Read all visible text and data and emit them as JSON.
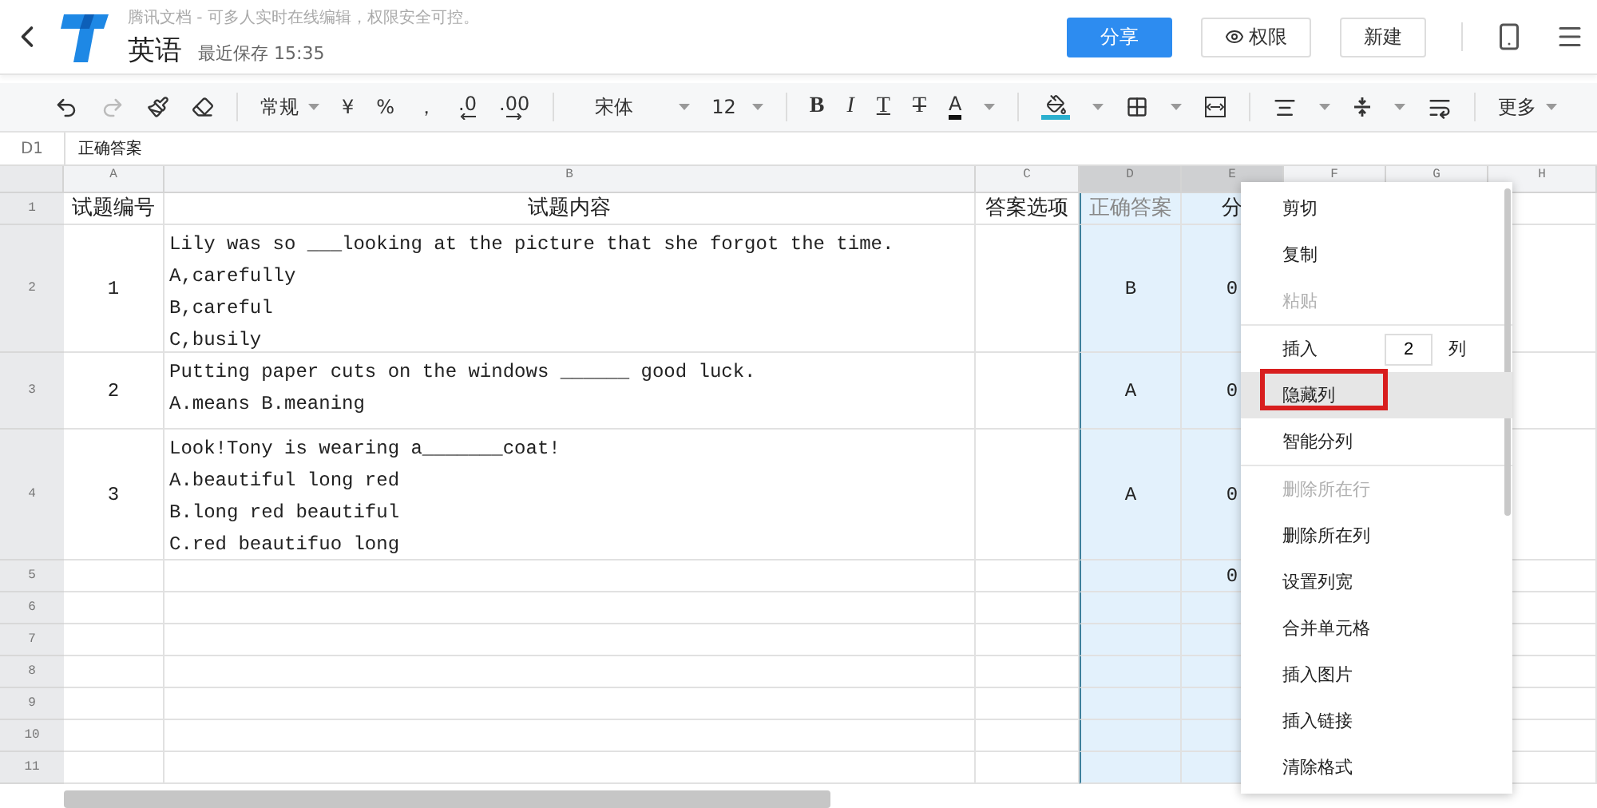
{
  "header": {
    "tagline": "腾讯文档 - 可多人实时在线编辑，权限安全可控。",
    "doc_title": "英语",
    "save_status": "最近保存 15:35",
    "buttons": [
      {
        "label": "分享",
        "kind": "primary"
      },
      {
        "label": "权限",
        "kind": "eye"
      },
      {
        "label": "新建",
        "kind": "plain"
      }
    ]
  },
  "toolbar": {
    "number_format": "常规",
    "currency": "¥",
    "percent": "%",
    "thousands": "，",
    "decimal_less": ".0",
    "decimal_more": ".00",
    "font": "宋体",
    "size": "12",
    "bold": "B",
    "italic": "I",
    "underline": "T",
    "strike": "T",
    "font_color": "A",
    "more": "更多"
  },
  "formula_bar": {
    "cell": "D1",
    "value": "正确答案"
  },
  "sheet": {
    "columns": [
      {
        "label": "A",
        "selected": false
      },
      {
        "label": "B",
        "selected": false
      },
      {
        "label": "C",
        "selected": false
      },
      {
        "label": "D",
        "selected": true
      },
      {
        "label": "E",
        "selected": true
      },
      {
        "label": "F",
        "selected": false
      },
      {
        "label": "G",
        "selected": false
      },
      {
        "label": "H",
        "selected": false
      }
    ],
    "rows": [
      {
        "number": "1",
        "cells": {
          "A": [
            "试题编号"
          ],
          "B": [
            "试题内容"
          ],
          "C": [
            "答案选项"
          ],
          "D": [
            "正确答案"
          ],
          "E": [
            "分"
          ]
        }
      },
      {
        "number": "2",
        "cells": {
          "A": [
            "1"
          ],
          "B": [
            "Lily was so ___looking at the picture that she forgot the time.",
            "A,carefully",
            "B,careful",
            "C,busily"
          ],
          "D": [
            "B"
          ],
          "E": [
            "0"
          ]
        }
      },
      {
        "number": "3",
        "cells": {
          "A": [
            "2"
          ],
          "B": [
            "Putting paper cuts on the windows ______ good luck.",
            "A.means B.meaning"
          ],
          "D": [
            "A"
          ],
          "E": [
            "0"
          ]
        }
      },
      {
        "number": "4",
        "cells": {
          "A": [
            "3"
          ],
          "B": [
            "Look!Tony is wearing a_______coat!",
            "A.beautiful long red",
            "B.long red beautiful",
            "C.red beautifuo long"
          ],
          "D": [
            "A"
          ],
          "E": [
            "0"
          ]
        }
      },
      {
        "number": "5",
        "cells": {
          "E": [
            "0"
          ]
        }
      },
      {
        "number": "6",
        "cells": {}
      },
      {
        "number": "7",
        "cells": {}
      },
      {
        "number": "8",
        "cells": {}
      },
      {
        "number": "9",
        "cells": {}
      },
      {
        "number": "10",
        "cells": {}
      },
      {
        "number": "11",
        "cells": {}
      }
    ]
  },
  "context_menu": {
    "items": [
      {
        "kind": "item",
        "label": "剪切",
        "disabled": false,
        "selected": false
      },
      {
        "kind": "item",
        "label": "复制",
        "disabled": false,
        "selected": false
      },
      {
        "kind": "item",
        "label": "粘贴",
        "disabled": true,
        "selected": false
      },
      {
        "kind": "separator"
      },
      {
        "kind": "insert",
        "label": "插入",
        "value": "2",
        "unit": "列",
        "disabled": false,
        "selected": false
      },
      {
        "kind": "item",
        "label": "隐藏列",
        "disabled": false,
        "selected": true
      },
      {
        "kind": "item",
        "label": "智能分列",
        "disabled": false,
        "selected": false
      },
      {
        "kind": "separator"
      },
      {
        "kind": "item",
        "label": "删除所在行",
        "disabled": true,
        "selected": false
      },
      {
        "kind": "item",
        "label": "删除所在列",
        "disabled": false,
        "selected": false
      },
      {
        "kind": "item",
        "label": "设置列宽",
        "disabled": false,
        "selected": false
      },
      {
        "kind": "item",
        "label": "合并单元格",
        "disabled": false,
        "selected": false
      },
      {
        "kind": "item",
        "label": "插入图片",
        "disabled": false,
        "selected": false
      },
      {
        "kind": "item",
        "label": "插入链接",
        "disabled": false,
        "selected": false
      },
      {
        "kind": "item",
        "label": "清除格式",
        "disabled": false,
        "selected": false
      }
    ]
  }
}
